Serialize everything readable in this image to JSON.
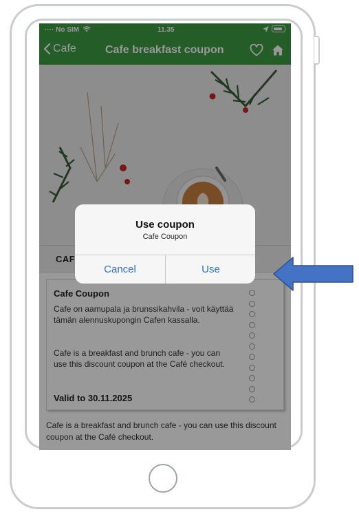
{
  "status_bar": {
    "carrier": "No SIM",
    "time": "11.35"
  },
  "nav": {
    "back_label": "Cafe",
    "title": "Cafe breakfast coupon"
  },
  "section": {
    "label": "CAF"
  },
  "coupon": {
    "title": "Cafe Coupon",
    "text_fi": "Cafe on aamupala ja brunssikahvila - voit käyttää tämän alennuskupongin Cafen kassalla.",
    "text_en": "Cafe is a breakfast and brunch cafe - you can use this discount coupon at the Café checkout.",
    "valid": "Valid to 30.11.2025"
  },
  "footer_text": "Cafe is a breakfast and brunch cafe - you can use this discount coupon at the Café checkout.",
  "alert": {
    "title": "Use coupon",
    "message": "Cafe Coupon",
    "cancel_label": "Cancel",
    "use_label": "Use"
  },
  "colors": {
    "brand_green": "#3c9b43",
    "ios_blue": "#2f6fcc",
    "arrow_blue": "#4472c4"
  },
  "icons": {
    "back": "chevron-left-icon",
    "favorite": "heart-icon",
    "home": "home-icon",
    "wifi": "wifi-icon",
    "battery": "battery-icon",
    "location": "location-icon",
    "pointer": "arrow-left-icon"
  }
}
